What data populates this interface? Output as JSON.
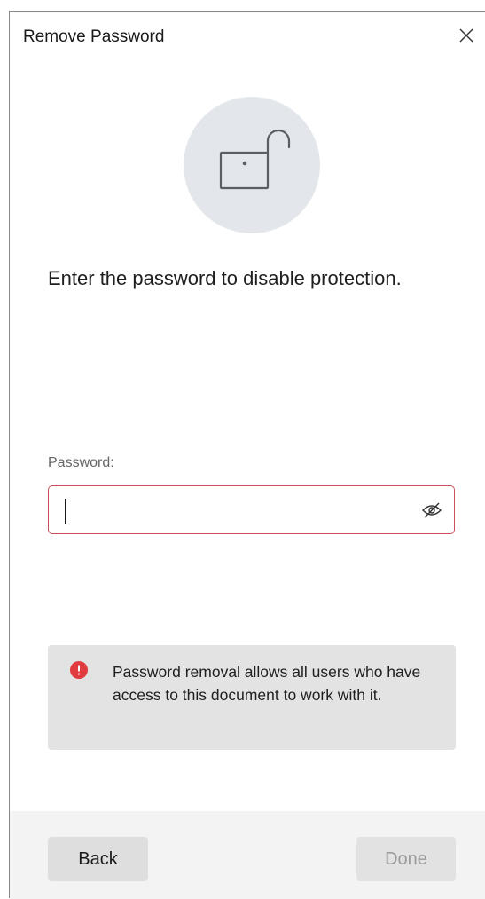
{
  "dialog": {
    "title": "Remove Password",
    "message": "Enter the password to disable protection.",
    "password_label": "Password:",
    "password_value": "",
    "warning_text": "Password removal allows all users who have access to this document to work with it.",
    "back_label": "Back",
    "done_label": "Done"
  },
  "icons": {
    "close": "close-icon",
    "lock": "unlocked-padlock-icon",
    "visibility": "eye-slash-icon",
    "warning": "exclamation-circle-icon"
  },
  "colors": {
    "field_border_error": "#c9505a",
    "warning_icon": "#e13a3f",
    "lock_circle": "#e3e6ea",
    "warning_box": "#e3e3e3",
    "footer": "#f3f3f3"
  }
}
